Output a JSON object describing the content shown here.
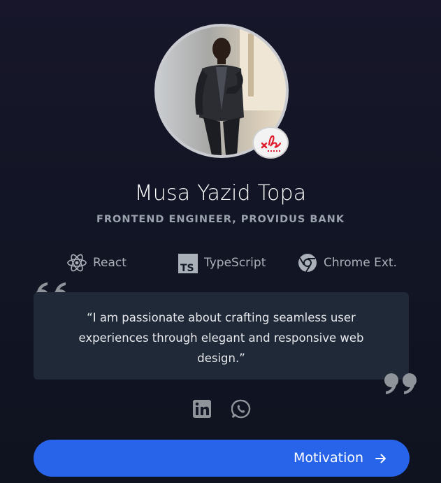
{
  "profile": {
    "name": "Musa Yazid Topa",
    "role": "FRONTEND ENGINEER, PROVIDUS BANK",
    "avatar_alt": "profile-photo",
    "badge_icon": "signature-icon"
  },
  "skills": [
    {
      "label": "React",
      "icon": "react-icon"
    },
    {
      "label": "TypeScript",
      "icon": "typescript-icon"
    },
    {
      "label": "Chrome Ext.",
      "icon": "chrome-icon"
    }
  ],
  "quote": {
    "text": "“I am passionate about crafting seamless user experiences through elegant and responsive web design.”"
  },
  "socials": [
    {
      "icon": "linkedin-icon"
    },
    {
      "icon": "whatsapp-icon"
    }
  ],
  "cta": {
    "label": "Motivation",
    "icon": "arrow-right-icon"
  },
  "colors": {
    "accent": "#2764ea",
    "background": "#111524",
    "card": "#202938",
    "muted": "#9aa2ad",
    "badge_red": "#e01b2c"
  }
}
